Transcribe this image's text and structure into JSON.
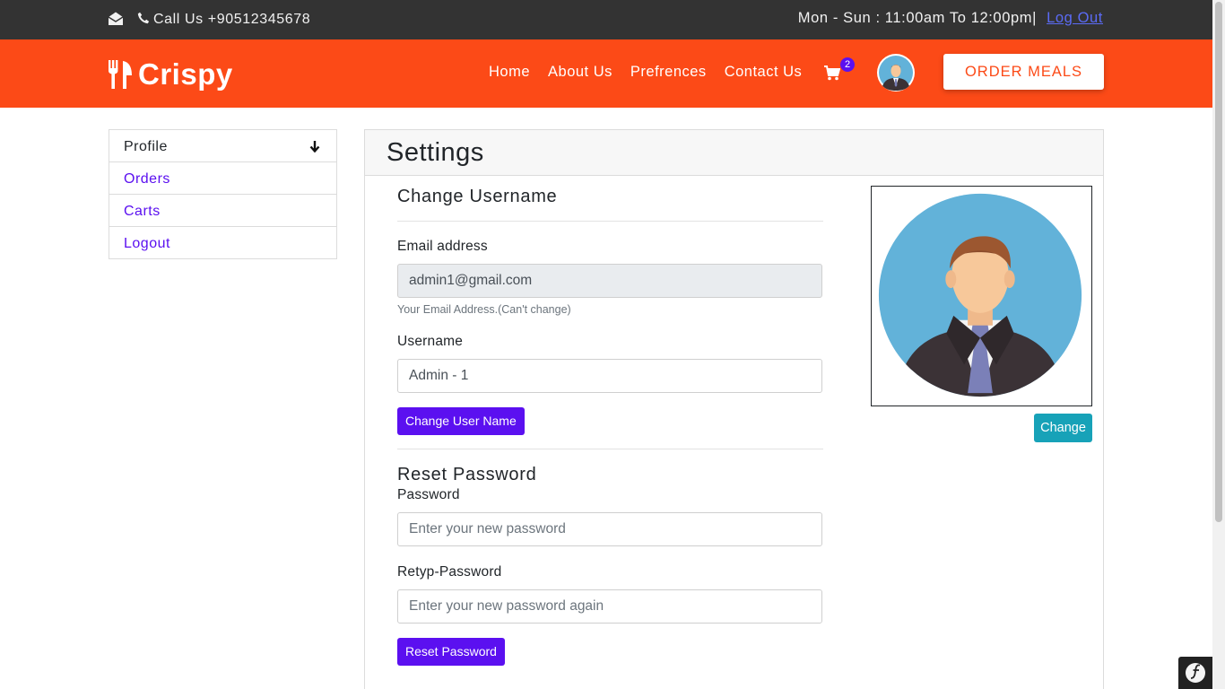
{
  "topbar": {
    "call": "Call Us +90512345678",
    "hours": "Mon - Sun : 11:00am To 12:00pm|",
    "logout": "Log Out"
  },
  "nav": {
    "brand": "Crispy",
    "links": [
      "Home",
      "About Us",
      "Prefrences",
      "Contact Us"
    ],
    "cart_count": "2",
    "order_button": "ORDER MEALS"
  },
  "sidebar": {
    "items": [
      {
        "label": "Profile"
      },
      {
        "label": "Orders"
      },
      {
        "label": "Carts"
      },
      {
        "label": "Logout"
      }
    ]
  },
  "settings": {
    "title": "Settings",
    "change_username": {
      "heading": "Change Username",
      "email_label": "Email address",
      "email_value": "admin1@gmail.com",
      "email_help": "Your Email Address.(Can't change)",
      "username_label": "Username",
      "username_value": "Admin - 1",
      "button": "Change User Name"
    },
    "reset_password": {
      "heading": "Reset Password",
      "password_label": "Password",
      "password_placeholder": "Enter your new password",
      "retype_label": "Retyp-Password",
      "retype_placeholder": "Enter your new password again",
      "button": "Reset Password"
    },
    "photo_button": "Change"
  },
  "colors": {
    "nav": "#fc4a17",
    "topbar": "#333333",
    "accent": "#5b10f0",
    "info": "#17a2b8"
  }
}
